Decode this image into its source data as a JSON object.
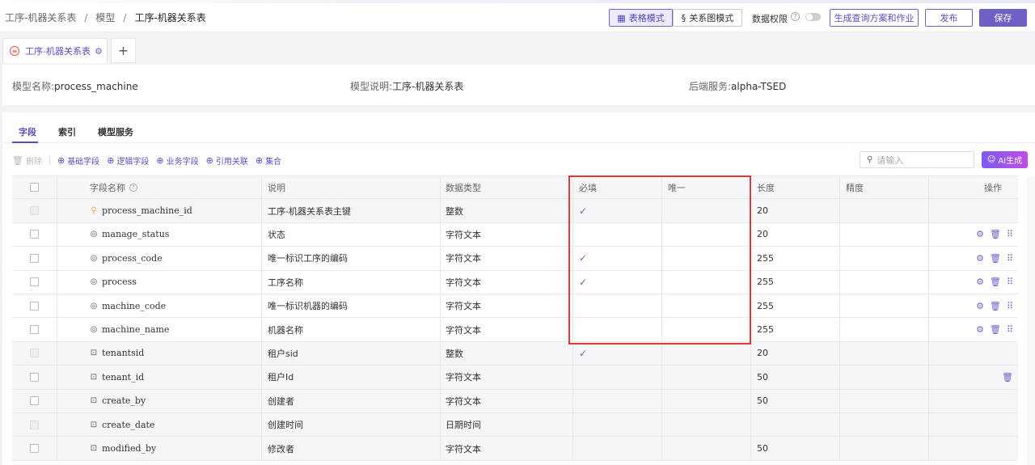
{
  "breadcrumb": [
    "工序-机器关系表",
    "模型",
    "工序-机器关系表"
  ],
  "header": {
    "mode_table": "表格模式",
    "mode_relation": "关系图模式",
    "data_permission": "数据权限",
    "generate_btn": "生成查询方案和作业",
    "publish_btn": "发布",
    "save_btn": "保存"
  },
  "tab": {
    "label": "工序-机器关系表",
    "add": "+"
  },
  "info": {
    "model_name_key": "模型名称:",
    "model_name": "process_machine",
    "model_desc_key": "模型说明:",
    "model_desc": "工序-机器关系表",
    "backend_key": "后端服务:",
    "backend": "alpha-TSED"
  },
  "subtabs": [
    "字段",
    "索引",
    "模型服务"
  ],
  "toolbar": {
    "delete": "删除",
    "basic_field": "基础字段",
    "logic_field": "逻辑字段",
    "business_field": "业务字段",
    "ref_relation": "引用关联",
    "collection": "集合"
  },
  "search": {
    "placeholder": "请输入"
  },
  "ai_btn": "AI生成",
  "columns": [
    "字段名称",
    "说明",
    "数据类型",
    "必填",
    "唯一",
    "长度",
    "精度",
    "操作"
  ],
  "rows": [
    {
      "name": "process_machine_id",
      "desc": "工序-机器关系表主键",
      "type": "整数",
      "required": "✓",
      "unique": "",
      "length": "20",
      "precision": "",
      "icon": "key-icon",
      "system": true,
      "ops": []
    },
    {
      "name": "manage_status",
      "desc": "状态",
      "type": "字符文本",
      "required": "",
      "unique": "",
      "length": "20",
      "precision": "",
      "icon": "field-icon",
      "system": false,
      "ops": [
        "settings",
        "delete",
        "drag"
      ]
    },
    {
      "name": "process_code",
      "desc": "唯一标识工序的编码",
      "type": "字符文本",
      "required": "✓",
      "unique": "",
      "length": "255",
      "precision": "",
      "icon": "field-icon",
      "system": false,
      "ops": [
        "settings",
        "delete",
        "drag"
      ]
    },
    {
      "name": "process",
      "desc": "工序名称",
      "type": "字符文本",
      "required": "✓",
      "unique": "",
      "length": "255",
      "precision": "",
      "icon": "field-icon",
      "system": false,
      "ops": [
        "settings",
        "delete",
        "drag"
      ]
    },
    {
      "name": "machine_code",
      "desc": "唯一标识机器的编码",
      "type": "字符文本",
      "required": "",
      "unique": "",
      "length": "255",
      "precision": "",
      "icon": "field-icon",
      "system": false,
      "ops": [
        "settings",
        "delete",
        "drag"
      ]
    },
    {
      "name": "machine_name",
      "desc": "机器名称",
      "type": "字符文本",
      "required": "",
      "unique": "",
      "length": "255",
      "precision": "",
      "icon": "field-icon",
      "system": false,
      "ops": [
        "settings",
        "delete",
        "drag"
      ]
    },
    {
      "name": "tenantsid",
      "desc": "租户sid",
      "type": "整数",
      "required": "✓",
      "unique": "",
      "length": "20",
      "precision": "",
      "icon": "sys-field-icon",
      "system": true,
      "ops": []
    },
    {
      "name": "tenant_id",
      "desc": "租户Id",
      "type": "字符文本",
      "required": "",
      "unique": "",
      "length": "50",
      "precision": "",
      "icon": "sys-field-icon",
      "system": true,
      "checkable": true,
      "ops": [
        "delete"
      ]
    },
    {
      "name": "create_by",
      "desc": "创建者",
      "type": "字符文本",
      "required": "",
      "unique": "",
      "length": "50",
      "precision": "",
      "icon": "sys-field-icon",
      "system": true,
      "checkable": true,
      "ops": []
    },
    {
      "name": "create_date",
      "desc": "创建时间",
      "type": "日期时间",
      "required": "",
      "unique": "",
      "length": "",
      "precision": "",
      "icon": "sys-field-icon",
      "system": true,
      "ops": []
    },
    {
      "name": "modified_by",
      "desc": "修改者",
      "type": "字符文本",
      "required": "",
      "unique": "",
      "length": "50",
      "precision": "",
      "icon": "sys-field-icon",
      "system": true,
      "checkable": true,
      "ops": []
    }
  ]
}
